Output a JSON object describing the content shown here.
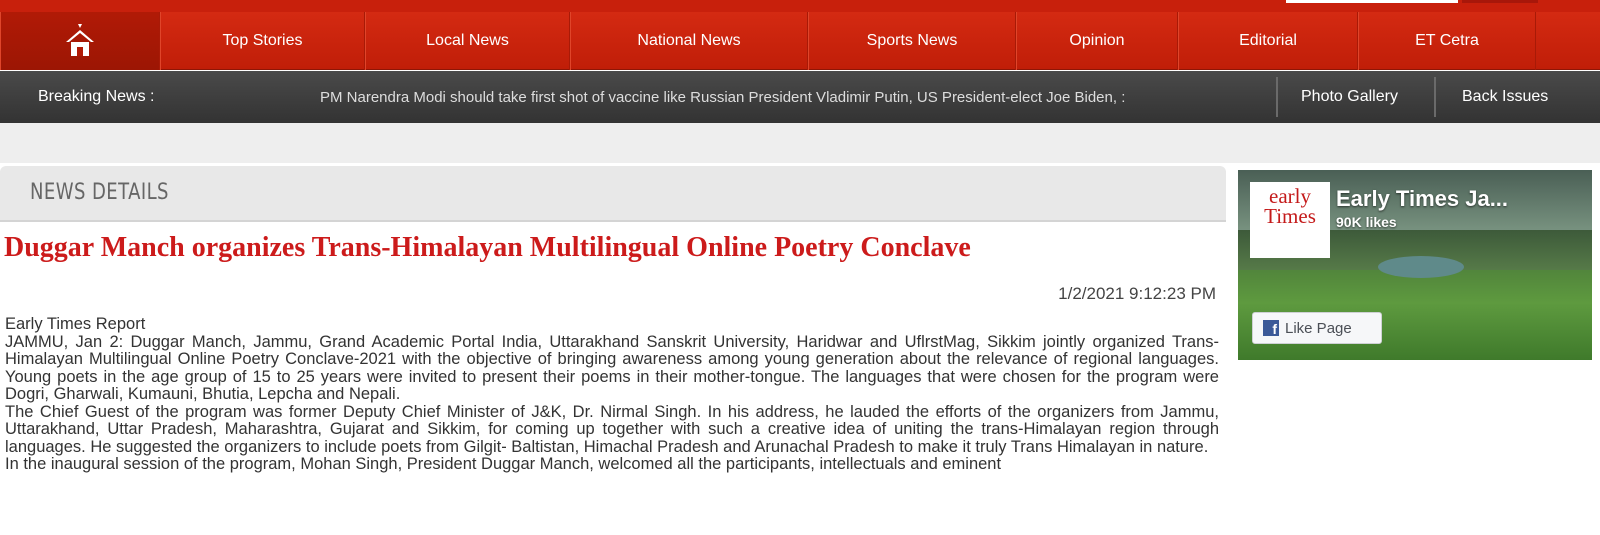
{
  "nav": {
    "home_icon": "home-icon",
    "items": [
      {
        "label": "Top Stories"
      },
      {
        "label": "Local News"
      },
      {
        "label": "National News"
      },
      {
        "label": "Sports News"
      },
      {
        "label": "Opinion"
      },
      {
        "label": "Editorial"
      },
      {
        "label": "ET Cetra"
      }
    ]
  },
  "breaking": {
    "label": "Breaking News :",
    "ticker": "PM Narendra Modi should take first shot of vaccine like Russian President Vladimir Putin, US President-elect Joe Biden, :",
    "links": [
      {
        "label": "Photo Gallery"
      },
      {
        "label": "Back Issues"
      }
    ]
  },
  "panel": {
    "heading": "NEWS DETAILS"
  },
  "article": {
    "headline": "Duggar Manch organizes Trans-Himalayan Multilingual Online Poetry Conclave",
    "timestamp": "1/2/2021 9:12:23 PM",
    "byline": "Early Times Report",
    "paragraphs": [
      "JAMMU, Jan 2: Duggar Manch, Jammu, Grand Academic Portal India, Uttarakhand Sanskrit University, Haridwar and UflrstMag, Sikkim jointly organized Trans-Himalayan Multilingual Online Poetry Conclave-2021 with the objective of bringing awareness among young generation about the relevance of regional languages. Young poets in the age group of 15 to 25 years were invited to present their poems in their mother-tongue. The languages that were chosen for the program were Dogri, Gharwali, Kumauni, Bhutia, Lepcha and Nepali.",
      "The Chief Guest of the program was former Deputy Chief Minister of J&K, Dr. Nirmal Singh. In his address, he lauded the efforts of the organizers from Jammu, Uttarakhand, Uttar Pradesh, Maharashtra, Gujarat and Sikkim, for coming up together with such a creative idea of uniting the trans-Himalayan region through languages. He suggested the organizers to include poets from Gilgit- Baltistan, Himachal Pradesh and Arunachal Pradesh to make it truly Trans Himalayan in nature.",
      "In the inaugural session of the program, Mohan Singh, President Duggar Manch, welcomed all the participants, intellectuals and eminent"
    ]
  },
  "facebook": {
    "page_name": "Early Times Ja...",
    "likes": "90K likes",
    "logo_line1": "early",
    "logo_line2": "Times",
    "like_button": "Like Page",
    "fb_icon": "facebook-icon"
  },
  "colors": {
    "nav_red": "#c8200c",
    "headline_red": "#cc1b1b",
    "breaking_bg": "#3a3a3a"
  }
}
